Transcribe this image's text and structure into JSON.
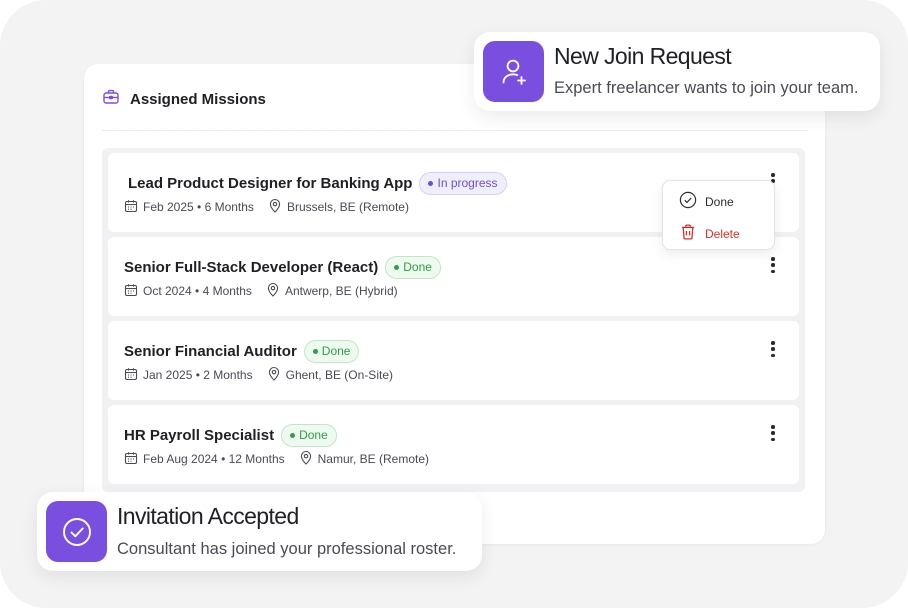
{
  "card": {
    "title": "Assigned Missions",
    "icon": "briefcase-icon"
  },
  "missions": [
    {
      "title": "Lead Product Designer for Banking App",
      "status": "In progress",
      "status_type": "progress",
      "date": "Feb 2025 • 6 Months",
      "location": "Brussels, BE (Remote)"
    },
    {
      "title": "Senior Full-Stack Developer (React)",
      "status": "Done",
      "status_type": "done",
      "date": "Oct 2024 • 4 Months",
      "location": "Antwerp, BE (Hybrid)"
    },
    {
      "title": "Senior Financial Auditor",
      "status": "Done",
      "status_type": "done",
      "date": "Jan 2025 • 2 Months",
      "location": "Ghent, BE (On-Site)"
    },
    {
      "title": "HR Payroll Specialist",
      "status": "Done",
      "status_type": "done",
      "date": "Feb Aug 2024 • 12 Months",
      "location": "Namur, BE (Remote)"
    }
  ],
  "menu": {
    "done_label": "Done",
    "delete_label": "Delete"
  },
  "toasts": {
    "join": {
      "title": "New Join Request",
      "subtitle": "Expert freelancer wants to join your team.",
      "icon": "user-add-icon"
    },
    "accepted": {
      "title": "Invitation Accepted",
      "subtitle": "Consultant has joined your professional roster.",
      "icon": "check-circle-icon"
    }
  },
  "colors": {
    "accent": "#7a4fe0",
    "progress": "#6a4fd6",
    "done": "#2f9e44",
    "danger": "#d93025"
  }
}
